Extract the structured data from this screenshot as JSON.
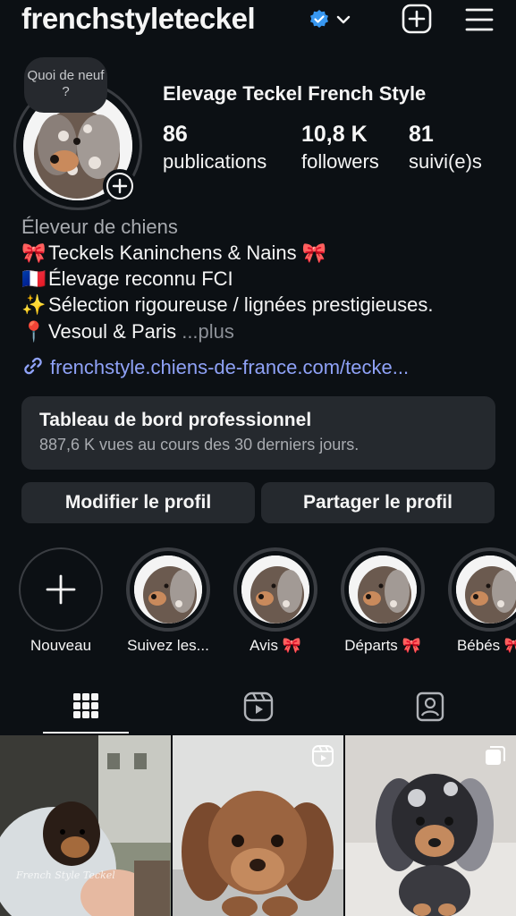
{
  "profile": {
    "username": "frenchstyleteckel",
    "full_name": "Elevage Teckel French Style",
    "note_bubble": "Quoi de neuf ?"
  },
  "stats": [
    {
      "value": "86",
      "label": "publications"
    },
    {
      "value": "10,8 K",
      "label": "followers"
    },
    {
      "value": "81",
      "label": "suivi(e)s"
    }
  ],
  "bio": {
    "category": "Éleveur de chiens",
    "lines": [
      {
        "emoji": "🎀",
        "text": "Teckels Kaninchens & Nains 🎀"
      },
      {
        "emoji": "🇫🇷",
        "text": "Élevage reconnu FCI"
      },
      {
        "emoji": "✨",
        "text": "Sélection rigoureuse / lignées prestigieuses."
      },
      {
        "emoji": "📍",
        "text": "Vesoul & Paris"
      }
    ],
    "more_label": "...plus",
    "link": "frenchstyle.chiens-de-france.com/tecke..."
  },
  "dashboard": {
    "title": "Tableau de bord professionnel",
    "subtitle": "887,6 K vues au cours des 30 derniers jours."
  },
  "buttons": {
    "edit": "Modifier le profil",
    "share": "Partager le profil"
  },
  "highlights": [
    {
      "label": "Nouveau",
      "icon": "plus-icon"
    },
    {
      "label": "Suivez les..."
    },
    {
      "label": "Avis 🎀"
    },
    {
      "label": "Départs 🎀"
    },
    {
      "label": "Bébés 🎀"
    }
  ],
  "tabs": [
    {
      "name": "grid",
      "icon": "grid-icon",
      "active": true
    },
    {
      "name": "reels",
      "icon": "reels-icon",
      "active": false
    },
    {
      "name": "tagged",
      "icon": "tagged-icon",
      "active": false
    }
  ],
  "posts": [
    {
      "overlay_text": "French Style Teckel",
      "type": "photo"
    },
    {
      "type": "reel"
    },
    {
      "type": "carousel"
    }
  ],
  "colors": {
    "background": "#0c1014",
    "surface": "#25292e",
    "link": "#8fa2f7",
    "verified": "#3897f0"
  }
}
